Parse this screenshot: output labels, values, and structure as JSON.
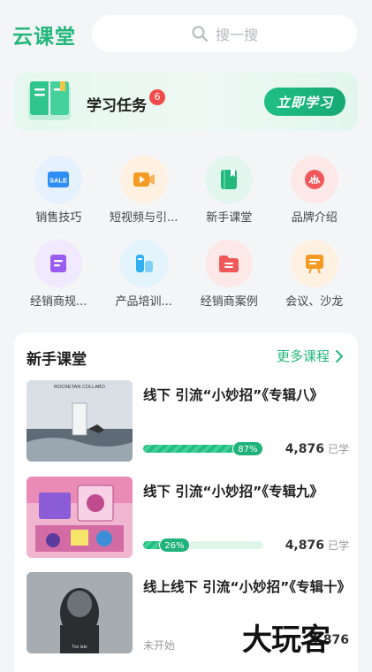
{
  "header": {
    "logo": "云课堂",
    "search_placeholder": "搜一搜"
  },
  "task": {
    "title": "学习任务",
    "badge": "6",
    "button": "立即学习"
  },
  "grid": [
    {
      "label": "销售技巧",
      "icon": "sale-tag-icon",
      "badge_text": "SALE",
      "color": "#2f8ef5",
      "bg": "#e6f1fe"
    },
    {
      "label": "短视频与引...",
      "icon": "video-camera-icon",
      "color": "#f59a22",
      "bg": "#fff1e2"
    },
    {
      "label": "新手课堂",
      "icon": "book-icon",
      "color": "#22b77b",
      "bg": "#e2f6ee"
    },
    {
      "label": "品牌介绍",
      "icon": "brand-emblem-icon",
      "color": "#f0585a",
      "bg": "#fde8e8"
    },
    {
      "label": "经销商规...",
      "icon": "document-icon",
      "color": "#9a5cf0",
      "bg": "#f1e9fe"
    },
    {
      "label": "产品培训...",
      "icon": "product-bottle-icon",
      "color": "#33b0f0",
      "bg": "#e4f4fd"
    },
    {
      "label": "经销商案例",
      "icon": "folder-icon",
      "color": "#f0585a",
      "bg": "#fde8e8"
    },
    {
      "label": "会议、沙龙",
      "icon": "presentation-board-icon",
      "color": "#f59a22",
      "bg": "#fff1e2"
    }
  ],
  "courses_section": {
    "title": "新手课堂",
    "more": "更多课程",
    "items": [
      {
        "title": "线下 引流“小妙招”《专辑八》",
        "progress": 87,
        "progress_label": "87%",
        "learners": "4,876",
        "learners_suffix": "已学",
        "thumb_text": "ROCKETAN COLLABO"
      },
      {
        "title": "线下 引流“小妙招”《专辑九》",
        "progress": 26,
        "progress_label": "26%",
        "learners": "4,876",
        "learners_suffix": "已学"
      },
      {
        "title": "线上线下 引流“小妙招”《专辑十》",
        "status": "未开始",
        "learners": "4,876",
        "thumb_text": "Too late"
      }
    ]
  },
  "watermark": "大玩客"
}
